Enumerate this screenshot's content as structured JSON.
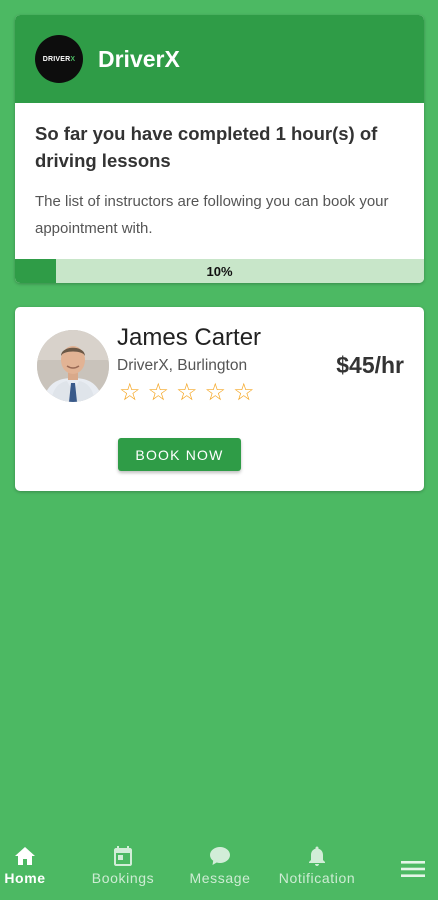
{
  "header": {
    "brand": "DriverX",
    "logo_text_main": "DRIVER",
    "logo_text_accent": "X"
  },
  "progress": {
    "title": "So far you have completed 1 hour(s) of driving lessons",
    "description": "The list of instructors are following you can book your appointment with.",
    "percent_label": "10%",
    "fraction": 0.1
  },
  "instructors": [
    {
      "name": "James Carter",
      "location": "DriverX, Burlington",
      "rate": "$45/hr",
      "rating": 0,
      "book_label": "BOOK NOW"
    }
  ],
  "nav": {
    "items": [
      {
        "label": "Home",
        "icon": "home-icon",
        "active": true
      },
      {
        "label": "Bookings",
        "icon": "calendar-icon",
        "active": false
      },
      {
        "label": "Message",
        "icon": "chat-bubble-icon",
        "active": false
      },
      {
        "label": "Notification",
        "icon": "bell-icon",
        "active": false
      }
    ],
    "menu_icon": "hamburger-menu-icon"
  },
  "colors": {
    "background": "#4cb963",
    "primary": "#2f9c47",
    "star": "#f5a623",
    "progress_track": "#c8e6c9"
  }
}
